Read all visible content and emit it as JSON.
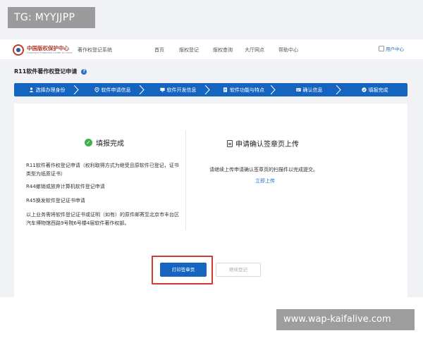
{
  "watermark": {
    "top": "TG: MYYJJPP",
    "bottom": "www.wap-kaifalive.com"
  },
  "header": {
    "logo_cn": "中国版权保护中心",
    "logo_en": "Copyright Protection Center of China",
    "system_name": "著作权登记系统",
    "nav": [
      "首页",
      "版权登记",
      "版权查询",
      "大厅网点",
      "帮助中心"
    ],
    "user_center": "用户中心"
  },
  "page": {
    "title": "R11软件著作权登记申请"
  },
  "steps": [
    {
      "icon": "user-icon",
      "label": "选择办理身份"
    },
    {
      "icon": "location-icon",
      "label": "软件申请信息"
    },
    {
      "icon": "monitor-icon",
      "label": "软件开发信息"
    },
    {
      "icon": "document-icon",
      "label": "软件功能与特点"
    },
    {
      "icon": "card-icon",
      "label": "确认信息"
    },
    {
      "icon": "check-icon",
      "label": "填报完成"
    }
  ],
  "complete": {
    "title": "填报完成",
    "line1": "R11软件著作权登记申请（权利取得方式为继受且原软件已登记，证书类型为纸质证书）",
    "line2": "R44撤销或放弃计算机软件登记申请",
    "line3": "R45换发软件登记证书申请",
    "line4": "以上业务需将软件登记证书或证明（如有）的原件邮寄至北京市丰台区汽车博物馆西路9号院6号楼4层软件著作权部。"
  },
  "upload": {
    "title": "申请确认签章页上传",
    "desc": "请继续上传申请确认签章页的扫描件以完成提交。",
    "link": "立即上传"
  },
  "buttons": {
    "print": "打印签章页",
    "continue": "继续登记"
  },
  "colors": {
    "primary": "#1565c0",
    "success": "#3fb14a",
    "highlight": "#d03a32"
  }
}
